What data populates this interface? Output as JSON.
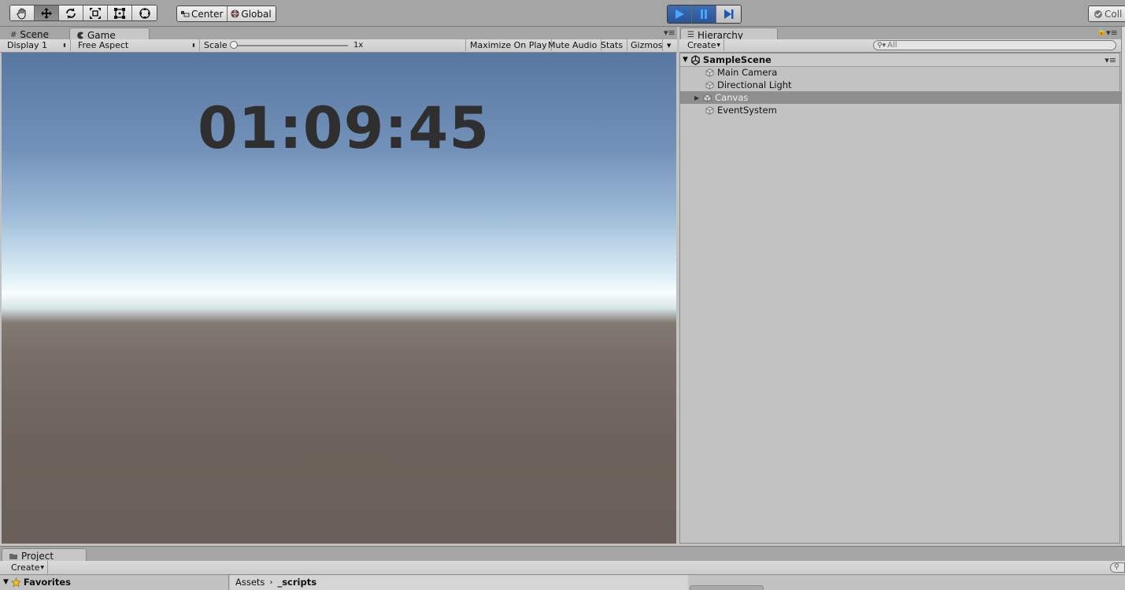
{
  "toolbar": {
    "tools": [
      "hand-tool",
      "move-tool",
      "rotate-tool",
      "scale-tool",
      "rect-tool",
      "transform-tool"
    ],
    "pivot_label": "Center",
    "space_label": "Global",
    "collab_label": "Coll"
  },
  "game_panel": {
    "tabs": [
      {
        "label": "Scene"
      },
      {
        "label": "Game"
      }
    ],
    "display": "Display 1",
    "aspect": "Free Aspect",
    "scale_label": "Scale",
    "scale_value": "1x",
    "maximize_label": "Maximize On Play",
    "mute_label": "Mute Audio",
    "stats_label": "Stats",
    "gizmos_label": "Gizmos",
    "timer": "01:09:45"
  },
  "hierarchy": {
    "tab_label": "Hierarchy",
    "create_label": "Create",
    "search_placeholder": "All",
    "scene_name": "SampleScene",
    "items": [
      {
        "label": "Main Camera"
      },
      {
        "label": "Directional Light"
      },
      {
        "label": "Canvas"
      },
      {
        "label": "EventSystem"
      }
    ]
  },
  "project": {
    "tab_label": "Project",
    "create_label": "Create",
    "favorites_label": "Favorites",
    "breadcrumb": [
      "Assets",
      "_scripts"
    ]
  },
  "colors": {
    "play_active": "#2a5596",
    "selection": "#8f8f8f"
  }
}
